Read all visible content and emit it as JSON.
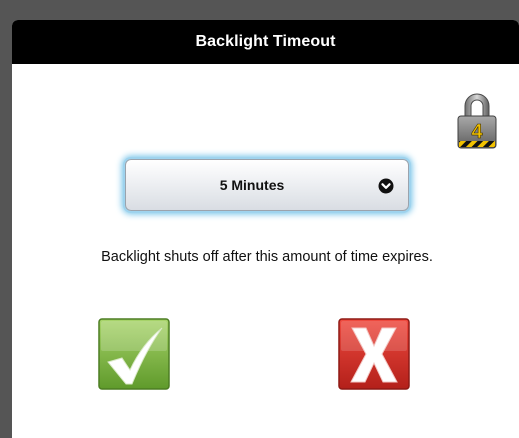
{
  "dialog": {
    "title": "Backlight Timeout",
    "lock_icon": "padlock-icon",
    "lock_level": "4",
    "select": {
      "value": "5 Minutes",
      "icon": "chevron-down-icon"
    },
    "description": "Backlight shuts off after this amount of time expires.",
    "confirm_icon": "checkmark-icon",
    "cancel_icon": "x-icon"
  },
  "colors": {
    "title_bar": "#000000",
    "confirm_green": "#7cb342",
    "cancel_red": "#d32f2f",
    "focus_glow": "#6fc1e8"
  }
}
